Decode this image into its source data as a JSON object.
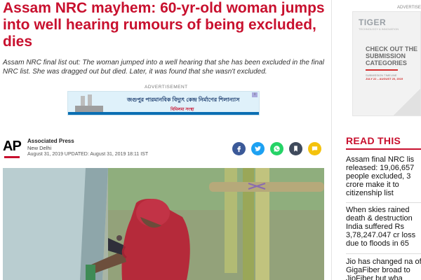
{
  "article": {
    "headline": "Assam NRC mayhem: 60-yr-old woman jumps into well hearing rumours of being excluded, dies",
    "summary": "Assam NRC final list out: The woman jumped into a well hearing that she has been excluded in the final NRC list. She was dragged out but died. Later, it was found that she wasn't excluded.",
    "ad_label": "ADVERTISEMENT",
    "ad_banner_text": "জগুপুর পারমানবিক বিদ্যুৎ কেন্দ্র নির্মাণের শিলান্যাস",
    "ad_banner_sub": "বিমিলমা সংস্থা"
  },
  "byline": {
    "logo": "AP",
    "author": "Associated Press",
    "location": "New Delhi",
    "dates": "August 31, 2019   UPDATED: August 31, 2019 18:11 IST"
  },
  "share_icons": [
    {
      "name": "facebook-icon",
      "color": "#3b5998"
    },
    {
      "name": "twitter-icon",
      "color": "#1da1f2"
    },
    {
      "name": "whatsapp-icon",
      "color": "#25d366"
    },
    {
      "name": "bookmark-icon",
      "color": "#3f4a5c"
    },
    {
      "name": "comment-icon",
      "color": "#f4c20d"
    }
  ],
  "sidebar": {
    "ad_label": "ADVERTISE",
    "tiger_logo": "TIGER",
    "tiger_sub": "TECHNOLOGY & INNOVATION",
    "ad_heading": "CHECK OUT THE SUBMISSION CATEGORIES",
    "ad_timeline_title": "SUBMISSION TIMELINE",
    "ad_timeline_dates": "JULY 22 – AUGUST 20, 2019",
    "read_this_title": "READ THIS",
    "stories": [
      "Assam final NRC lis released: 19,06,657 people excluded, 3 crore make it to citizenship list",
      "When skies rained death & destruction India suffered Rs 3,78,247.047 cr loss due to floods in 65",
      "Jio has changed na of GigaFiber broad to JioFiber but wha"
    ]
  },
  "colors": {
    "headline": "#c8102e",
    "accent": "#c8102e"
  }
}
